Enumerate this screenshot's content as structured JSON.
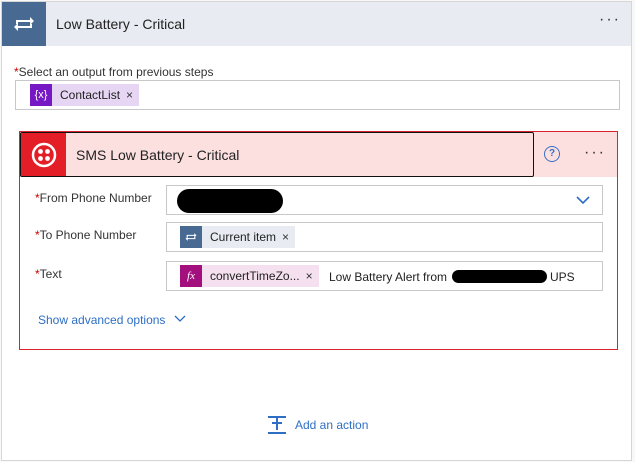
{
  "header": {
    "title": "Low Battery - Critical",
    "more": "···"
  },
  "select": {
    "label": "Select an output from previous steps",
    "token": {
      "label": "ContactList",
      "icon": "{x}"
    }
  },
  "action_card": {
    "title": "SMS Low Battery - Critical",
    "help": "?",
    "more": "···",
    "fields": {
      "from": {
        "label": "From Phone Number"
      },
      "to": {
        "label": "To Phone Number",
        "token": "Current item"
      },
      "text": {
        "label": "Text",
        "token": "convertTimeZo...",
        "token_icon": "fx",
        "text_before": "Low Battery Alert from",
        "text_after": "UPS"
      }
    },
    "advanced": "Show advanced options"
  },
  "add_action": {
    "label": "Add an action"
  },
  "colors": {
    "accent": "#486991",
    "twilio": "#e31e26",
    "variable": "#7718c5",
    "expression": "#a3107d",
    "link": "#2e6ec4",
    "card_border": "#d9232e"
  }
}
